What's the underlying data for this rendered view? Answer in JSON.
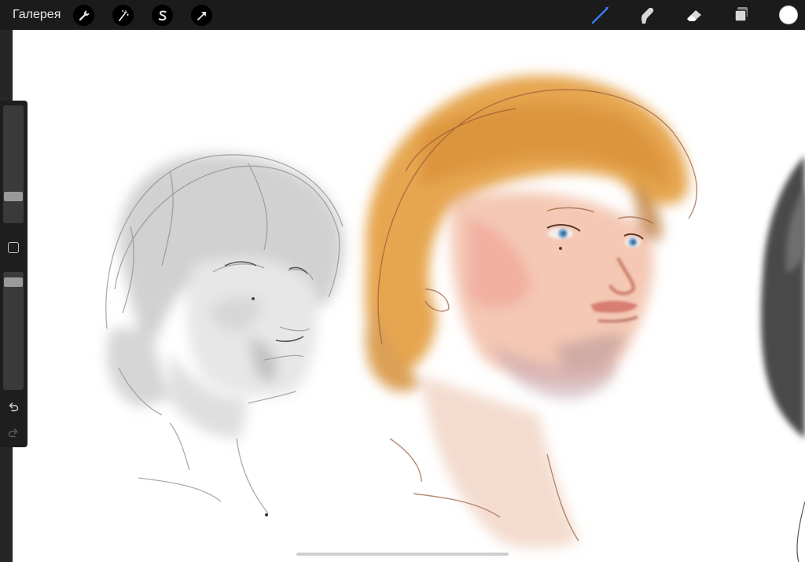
{
  "topbar": {
    "gallery_label": "Галерея",
    "left_tools": [
      {
        "icon": "wrench-icon",
        "name": "actions"
      },
      {
        "icon": "magic-wand-icon",
        "name": "adjustments"
      },
      {
        "icon": "selection-s-icon",
        "name": "selection"
      },
      {
        "icon": "arrow-cursor-icon",
        "name": "transform"
      }
    ],
    "right_tools": [
      {
        "icon": "brush-icon",
        "name": "paint",
        "active": true
      },
      {
        "icon": "smudge-finger-icon",
        "name": "smudge"
      },
      {
        "icon": "eraser-icon",
        "name": "erase"
      },
      {
        "icon": "layers-icon",
        "name": "layers"
      }
    ],
    "active_tool_color": "#3a7bf2",
    "current_color": "#ffffff"
  },
  "sidebar": {
    "brush_size_level": 0.2,
    "opacity_level": 0.95
  },
  "colors": {
    "chrome": "#1b1b1b",
    "canvas": "#ffffff"
  }
}
